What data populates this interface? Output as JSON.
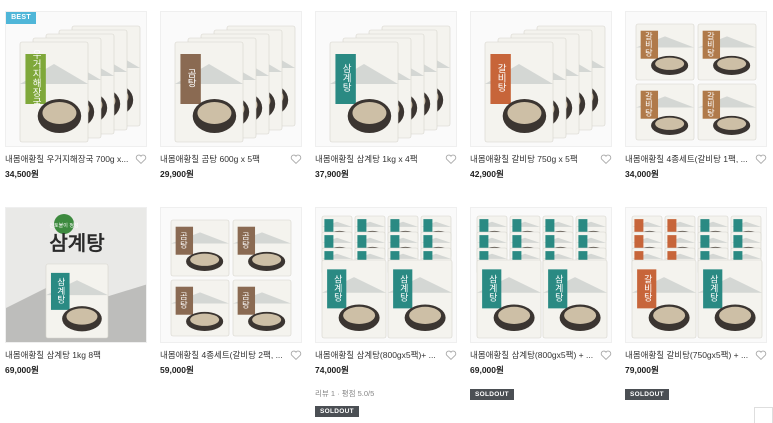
{
  "badge": {
    "best": "BEST"
  },
  "products": [
    {
      "name": "내몸애황칠 우거지해장국 700g x...",
      "price": "34,500원",
      "tint": "#7fa83a",
      "label": "우거지해장국"
    },
    {
      "name": "내몸애황칠 곰탕 600g x 5팩",
      "price": "29,900원",
      "tint": "#8a6a52",
      "label": "곰탕"
    },
    {
      "name": "내몸애황칠 삼계탕 1kg x 4팩",
      "price": "37,900원",
      "tint": "#2a8a83",
      "label": "삼계탕"
    },
    {
      "name": "내몸애황칠 갈비탕 750g x 5팩",
      "price": "42,900원",
      "tint": "#c7653a",
      "label": "갈비탕"
    },
    {
      "name": "내몸애황칠 4종세트(갈비탕 1팩, ...",
      "price": "34,000원",
      "tint": "#b07a4a",
      "label": "갈비탕"
    },
    {
      "name": "내몸애황칠 삼계탕 1kg 8팩",
      "price": "69,000원",
      "tint": "#2a8a83",
      "label": "삼계탕",
      "banner": "삼계탕",
      "stamp": "신토불이 정성"
    },
    {
      "name": "내몸애황칠 4종세트(갈비탕 2팩, ...",
      "price": "59,000원",
      "tint": "#8a6a52",
      "label": "곰탕"
    },
    {
      "name": "내몸애황칠 삼계탕(800gx5팩)+ ...",
      "price": "74,000원",
      "tint": "#2a8a83",
      "label": "삼계탕",
      "review": "리뷰 1 · 평점 5.0/5",
      "soldout": "SOLDOUT"
    },
    {
      "name": "내몸애황칠 삼계탕(800gx5팩) + ...",
      "price": "69,000원",
      "tint": "#2a8a83",
      "label": "삼계탕",
      "soldout": "SOLDOUT"
    },
    {
      "name": "내몸애황칠 갈비탕(750gx5팩) + ...",
      "price": "79,000원",
      "tint": "#c7653a",
      "label": "갈비탕",
      "soldout": "SOLDOUT"
    }
  ]
}
